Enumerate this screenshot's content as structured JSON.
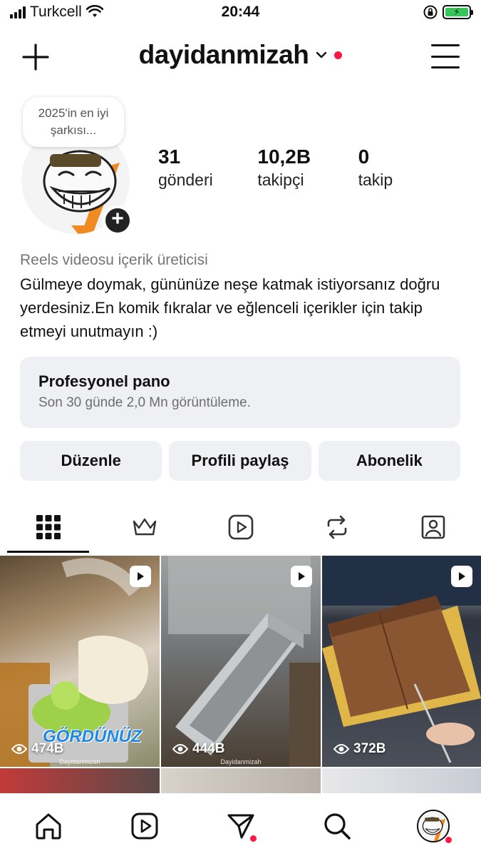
{
  "status_bar": {
    "carrier": "Turkcell",
    "time": "20:44",
    "battery_symbol": "⚡"
  },
  "header": {
    "username": "dayidanmizah",
    "has_notification_dot": true
  },
  "profile": {
    "note": "2025'in en iyi şarkısı...",
    "stats": [
      {
        "value": "31",
        "label": "gönderi"
      },
      {
        "value": "10,2B",
        "label": "takipçi"
      },
      {
        "value": "0",
        "label": "takip"
      }
    ],
    "category": "Reels videosu içerik üreticisi",
    "bio": "Gülmeye doymak, gününüze neşe katmak istiyorsanız doğru yerdesiniz.En komik fıkralar ve eğlenceli içerikler için takip etmeyi unutmayın :)"
  },
  "pro_dashboard": {
    "title": "Profesyonel pano",
    "subtitle": "Son 30 günde 2,0 Mn görüntüleme."
  },
  "actions": {
    "edit": "Düzenle",
    "share": "Profili paylaş",
    "subscription": "Abonelik"
  },
  "tabs": [
    {
      "icon": "grid-icon"
    },
    {
      "icon": "crown-icon"
    },
    {
      "icon": "reels-icon"
    },
    {
      "icon": "repost-icon"
    },
    {
      "icon": "tagged-icon"
    }
  ],
  "posts": [
    {
      "views": "474B",
      "overlay": "GÖRDÜNÜZ",
      "watermark": "Dayidanmizah",
      "bg": "#9a8a6a"
    },
    {
      "views": "444B",
      "overlay": "",
      "watermark": "Dayidanmizah",
      "bg": "#7d7e80"
    },
    {
      "views": "372B",
      "overlay": "",
      "watermark": "",
      "bg": "#5a4a3a"
    }
  ],
  "colors": {
    "accent_red": "#ff1744",
    "panel_bg": "#eff0f3",
    "battery_green": "#34c759"
  }
}
